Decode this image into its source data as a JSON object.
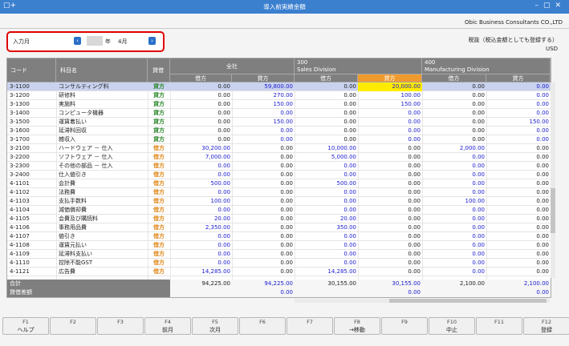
{
  "window": {
    "title": "導入前実績金額",
    "left_glyph": "▢+",
    "controls": "–▢✕"
  },
  "company": "Obic Business Consultants CO.,LTD",
  "period": {
    "label": "入力月",
    "prev": "‹",
    "next": "›",
    "year_suffix": "年",
    "month": "4月"
  },
  "tax_note": "税抜（税込金額としても登録する）",
  "currency": "USD",
  "headers": {
    "code": "コード",
    "name": "科目名",
    "dc": "貸借",
    "groups": [
      {
        "code": "",
        "name": "全社"
      },
      {
        "code": "300",
        "name": "Sales Division"
      },
      {
        "code": "400",
        "name": "Manufacturing Division"
      }
    ],
    "debit": "借方",
    "credit": "貸方"
  },
  "rows": [
    {
      "code": "3-1100",
      "name": "コンサルティング料",
      "dc": "貸方",
      "side": "c",
      "v": [
        "0.00",
        "59,800.00",
        "0.00",
        "20,000.00",
        "0.00",
        "0.00"
      ]
    },
    {
      "code": "3-1200",
      "name": "研修料",
      "dc": "貸方",
      "side": "c",
      "v": [
        "0.00",
        "270.00",
        "0.00",
        "100.00",
        "0.00",
        "0.00"
      ]
    },
    {
      "code": "3-1300",
      "name": "実施料",
      "dc": "貸方",
      "side": "c",
      "v": [
        "0.00",
        "150.00",
        "0.00",
        "150.00",
        "0.00",
        "0.00"
      ]
    },
    {
      "code": "3-1400",
      "name": "コンピュータ機器",
      "dc": "貸方",
      "side": "c",
      "v": [
        "0.00",
        "0.00",
        "0.00",
        "0.00",
        "0.00",
        "0.00"
      ]
    },
    {
      "code": "3-1500",
      "name": "運賃着払い",
      "dc": "貸方",
      "side": "c",
      "v": [
        "0.00",
        "150.00",
        "0.00",
        "0.00",
        "0.00",
        "150.00"
      ]
    },
    {
      "code": "3-1600",
      "name": "延滞料回収",
      "dc": "貸方",
      "side": "c",
      "v": [
        "0.00",
        "0.00",
        "0.00",
        "0.00",
        "0.00",
        "0.00"
      ]
    },
    {
      "code": "3-1700",
      "name": "雑収入",
      "dc": "貸方",
      "side": "c",
      "v": [
        "0.00",
        "0.00",
        "0.00",
        "0.00",
        "0.00",
        "0.00"
      ]
    },
    {
      "code": "3-2100",
      "name": "ハードウェア － 仕入",
      "dc": "借方",
      "side": "d",
      "v": [
        "30,200.00",
        "0.00",
        "10,000.00",
        "0.00",
        "2,000.00",
        "0.00"
      ]
    },
    {
      "code": "3-2200",
      "name": "ソフトウェア － 仕入",
      "dc": "借方",
      "side": "d",
      "v": [
        "7,000.00",
        "0.00",
        "5,000.00",
        "0.00",
        "0.00",
        "0.00"
      ]
    },
    {
      "code": "3-2300",
      "name": "その他の部品 － 仕入",
      "dc": "借方",
      "side": "d",
      "v": [
        "0.00",
        "0.00",
        "0.00",
        "0.00",
        "0.00",
        "0.00"
      ]
    },
    {
      "code": "3-2400",
      "name": "仕入値引き",
      "dc": "借方",
      "side": "d",
      "v": [
        "0.00",
        "0.00",
        "0.00",
        "0.00",
        "0.00",
        "0.00"
      ]
    },
    {
      "code": "4-1101",
      "name": "会計費",
      "dc": "借方",
      "side": "d",
      "v": [
        "500.00",
        "0.00",
        "500.00",
        "0.00",
        "0.00",
        "0.00"
      ]
    },
    {
      "code": "4-1102",
      "name": "法務費",
      "dc": "借方",
      "side": "d",
      "v": [
        "0.00",
        "0.00",
        "0.00",
        "0.00",
        "0.00",
        "0.00"
      ]
    },
    {
      "code": "4-1103",
      "name": "支払手数料",
      "dc": "借方",
      "side": "d",
      "v": [
        "100.00",
        "0.00",
        "0.00",
        "0.00",
        "100.00",
        "0.00"
      ]
    },
    {
      "code": "4-1104",
      "name": "減価償却費",
      "dc": "借方",
      "side": "d",
      "v": [
        "0.00",
        "0.00",
        "0.00",
        "0.00",
        "0.00",
        "0.00"
      ]
    },
    {
      "code": "4-1105",
      "name": "会費及び購読料",
      "dc": "借方",
      "side": "d",
      "v": [
        "20.00",
        "0.00",
        "20.00",
        "0.00",
        "0.00",
        "0.00"
      ]
    },
    {
      "code": "4-1106",
      "name": "事務用品費",
      "dc": "借方",
      "side": "d",
      "v": [
        "2,350.00",
        "0.00",
        "350.00",
        "0.00",
        "0.00",
        "0.00"
      ]
    },
    {
      "code": "4-1107",
      "name": "値引き",
      "dc": "借方",
      "side": "d",
      "v": [
        "0.00",
        "0.00",
        "0.00",
        "0.00",
        "0.00",
        "0.00"
      ]
    },
    {
      "code": "4-1108",
      "name": "運賃元払い",
      "dc": "借方",
      "side": "d",
      "v": [
        "0.00",
        "0.00",
        "0.00",
        "0.00",
        "0.00",
        "0.00"
      ]
    },
    {
      "code": "4-1109",
      "name": "延滞料支払い",
      "dc": "借方",
      "side": "d",
      "v": [
        "0.00",
        "0.00",
        "0.00",
        "0.00",
        "0.00",
        "0.00"
      ]
    },
    {
      "code": "4-1110",
      "name": "控除不能GST",
      "dc": "借方",
      "side": "d",
      "v": [
        "0.00",
        "0.00",
        "0.00",
        "0.00",
        "0.00",
        "0.00"
      ]
    },
    {
      "code": "4-1121",
      "name": "広告費",
      "dc": "借方",
      "side": "d",
      "v": [
        "14,285.00",
        "0.00",
        "14,285.00",
        "0.00",
        "0.00",
        "0.00"
      ]
    }
  ],
  "totals": {
    "label": "合計",
    "v": [
      "94,225.00",
      "94,225.00",
      "30,155.00",
      "30,155.00",
      "2,100.00",
      "2,100.00"
    ]
  },
  "diff": {
    "label": "貸借差額",
    "v": [
      "0.00",
      "",
      "0.00",
      "",
      "0.00",
      ""
    ]
  },
  "fkeys": [
    {
      "key": "F1",
      "label": "ヘルプ"
    },
    {
      "key": "F2",
      "label": ""
    },
    {
      "key": "F3",
      "label": ""
    },
    {
      "key": "F4",
      "label": "前月"
    },
    {
      "key": "F5",
      "label": "次月"
    },
    {
      "key": "F6",
      "label": ""
    },
    {
      "key": "F7",
      "label": ""
    },
    {
      "key": "F8",
      "label": "→移動"
    },
    {
      "key": "F9",
      "label": ""
    },
    {
      "key": "F10",
      "label": "中止"
    },
    {
      "key": "F11",
      "label": ""
    },
    {
      "key": "F12",
      "label": "登録"
    }
  ]
}
